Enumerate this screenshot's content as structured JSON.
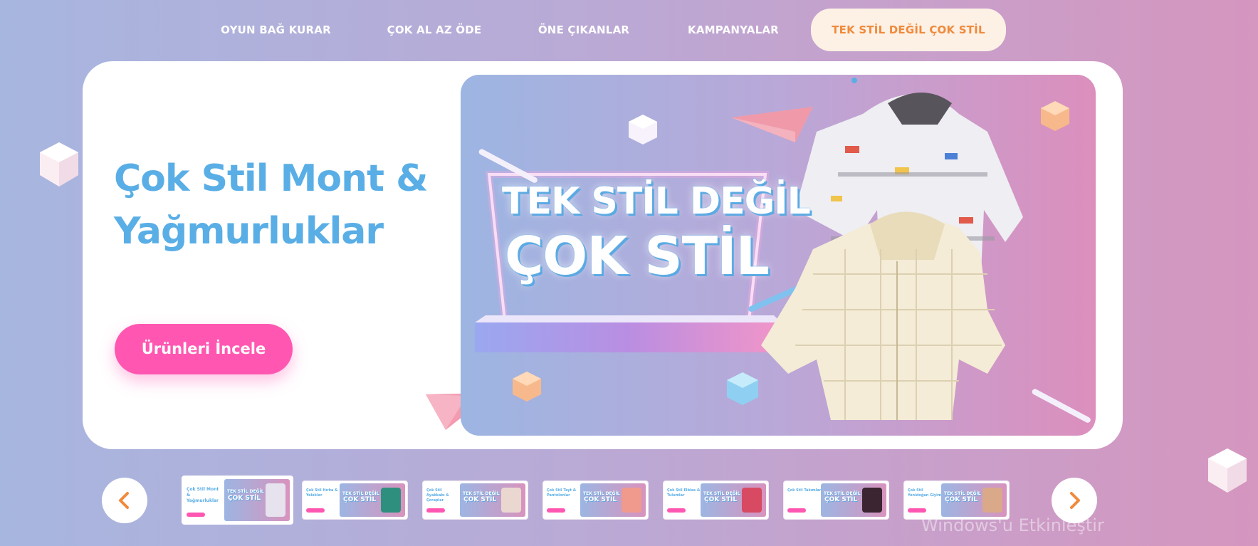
{
  "nav": {
    "items": [
      {
        "label": "OYUN BAĞ KURAR",
        "active": false
      },
      {
        "label": "ÇOK AL AZ ÖDE",
        "active": false
      },
      {
        "label": "ÖNE ÇIKANLAR",
        "active": false
      },
      {
        "label": "KAMPANYALAR",
        "active": false
      },
      {
        "label": "TEK STİL DEĞİL ÇOK STİL",
        "active": true
      }
    ]
  },
  "hero": {
    "title": "Çok Stil Mont & Yağmurluklar",
    "cta_label": "Ürünleri İncele",
    "banner_line1": "TEK STİL DEĞİL",
    "banner_line2": "ÇOK STİL"
  },
  "carousel": {
    "prev_icon": "chevron-left-icon",
    "next_icon": "chevron-right-icon",
    "thumbnails": [
      {
        "label": "Çok Stil Mont & Yağmurluklar",
        "product_color": "#d9d5e6",
        "active": true
      },
      {
        "label": "Çok Stil Hırka & Yelekler",
        "product_color": "#2f8f7f",
        "active": false
      },
      {
        "label": "Çok Stil Ayakkabı & Çoraplar",
        "product_color": "#e9d7cf",
        "active": false
      },
      {
        "label": "Çok Stil Tayt & Pantolonlar",
        "product_color": "#f09a8e",
        "active": false
      },
      {
        "label": "Çok Stil Elbise & Tulumlar",
        "product_color": "#d84a62",
        "active": false
      },
      {
        "label": "Çok Stil Takımlar",
        "product_color": "#3a2530",
        "active": false
      },
      {
        "label": "Çok Stil Yenidoğan Giyim",
        "product_color": "#d9a98a",
        "active": false
      }
    ]
  },
  "watermark": "Windows'u Etkinleştir",
  "colors": {
    "accent_orange": "#f08a3c",
    "cta_pink": "#ff57b1",
    "title_blue": "#5aaee6",
    "active_tab_bg": "#fdf1e6"
  }
}
